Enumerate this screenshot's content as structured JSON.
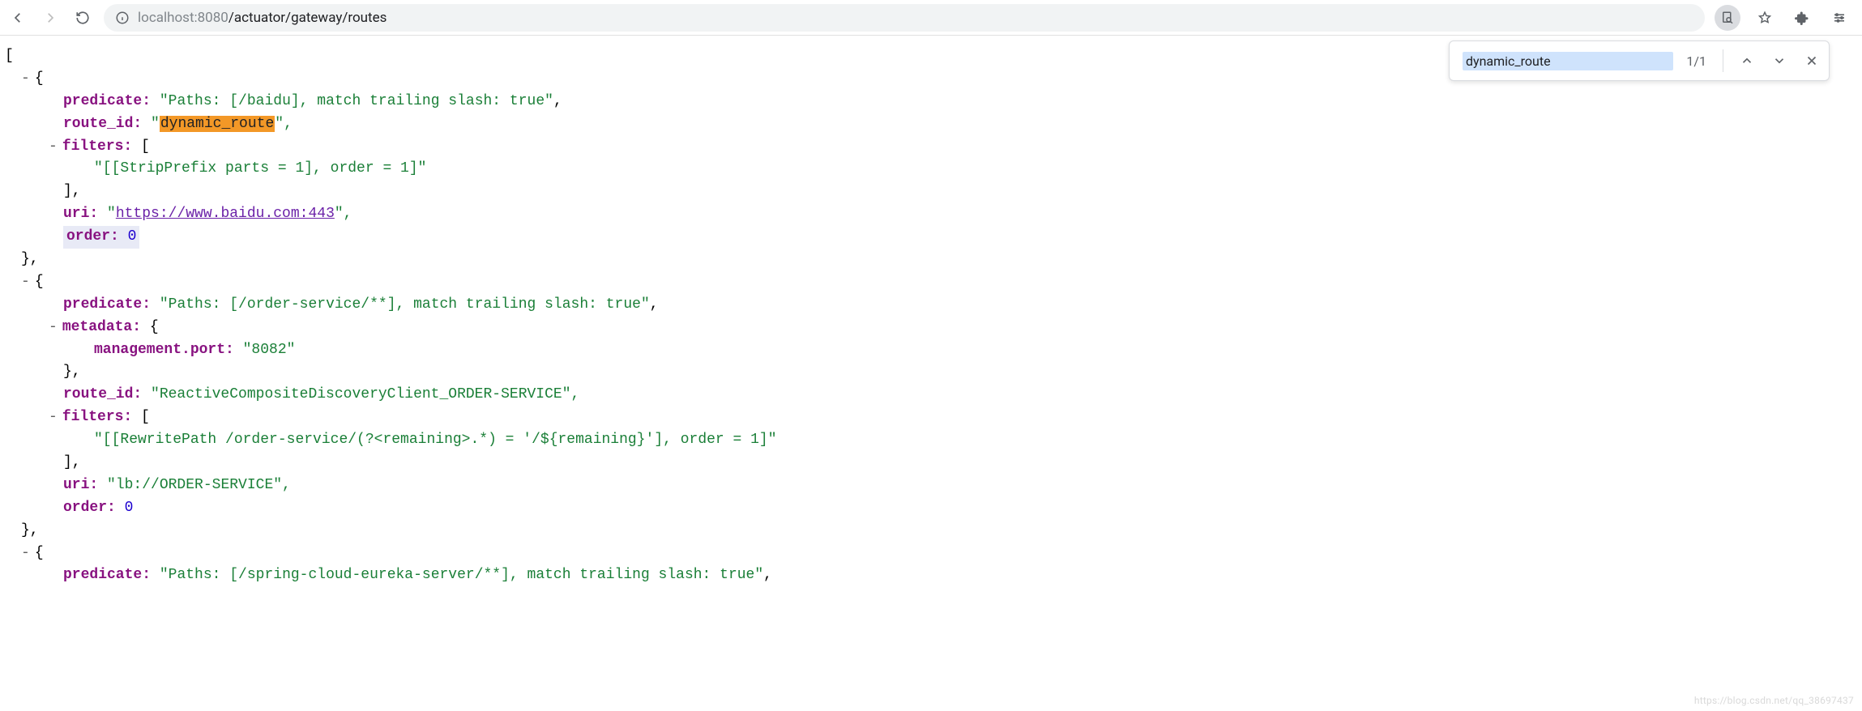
{
  "address_bar": {
    "host_grey": "localhost",
    "host_port": ":8080",
    "path": "/actuator/gateway/routes"
  },
  "find_bar": {
    "term": "dynamic_route",
    "count": "1/1"
  },
  "json": {
    "open_bracket": "[",
    "routes": [
      {
        "predicate_key": "predicate:",
        "predicate_val": "\"Paths: [/baidu], match trailing slash: true\"",
        "route_id_key": "route_id:",
        "route_id_prefix_quote": "\"",
        "route_id_match": "dynamic_route",
        "route_id_suffix": "\",",
        "filters_key": "filters:",
        "filters_open": " [",
        "filters_item": "\"[[StripPrefix parts = 1], order = 1]\"",
        "filters_close": "],",
        "uri_key": "uri:",
        "uri_prefix": " \"",
        "uri_link": "https://www.baidu.com:443",
        "uri_suffix": "\",",
        "order_key": "order:",
        "order_val": " 0"
      },
      {
        "predicate_key": "predicate:",
        "predicate_val": "\"Paths: [/order-service/**], match trailing slash: true\"",
        "metadata_key": "metadata:",
        "metadata_open": " {",
        "metadata_inner_key": "management.port:",
        "metadata_inner_val": " \"8082\"",
        "metadata_close": "},",
        "route_id_key": "route_id:",
        "route_id_val": " \"ReactiveCompositeDiscoveryClient_ORDER-SERVICE\",",
        "filters_key": "filters:",
        "filters_open": " [",
        "filters_item": "\"[[RewritePath /order-service/(?<remaining>.*) = '/${remaining}'], order = 1]\"",
        "filters_close": "],",
        "uri_key": "uri:",
        "uri_val": " \"lb://ORDER-SERVICE\",",
        "order_key": "order:",
        "order_val": " 0"
      },
      {
        "predicate_key": "predicate:",
        "predicate_val": "\"Paths: [/spring-cloud-eureka-server/**], match trailing slash: true\""
      }
    ],
    "brace_open_dash": "- {",
    "brace_close_comma": "},"
  },
  "watermark": "https://blog.csdn.net/qq_38697437"
}
